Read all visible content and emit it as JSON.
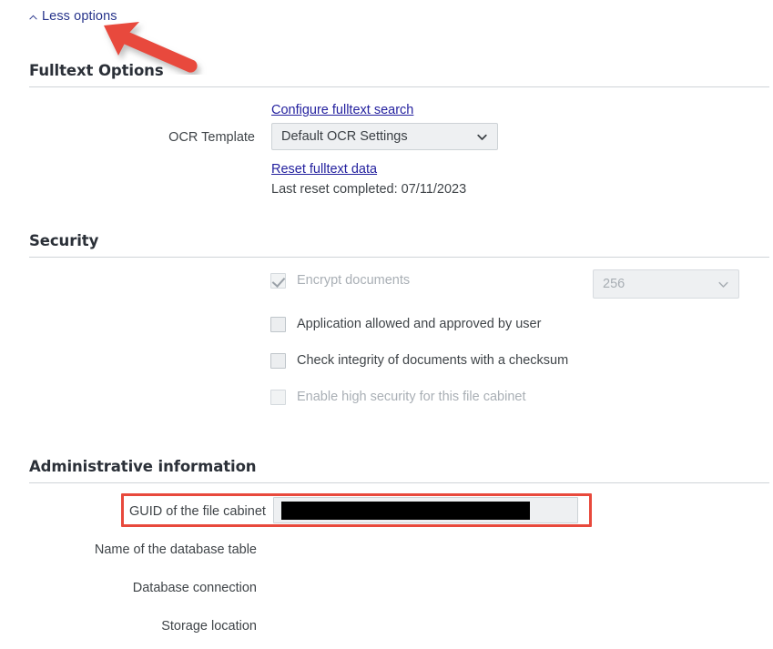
{
  "toggle": {
    "label": "Less options",
    "icon": "chevron-up-icon"
  },
  "annotation": {
    "shape": "arrow",
    "color": "#e8493c",
    "points_to": "Less options"
  },
  "sections": {
    "fulltext": {
      "title": "Fulltext Options",
      "configure_link": "Configure fulltext search",
      "ocr_template_label": "OCR Template",
      "ocr_template_value": "Default OCR Settings",
      "reset_link": "Reset fulltext data",
      "last_reset": "Last reset completed: 07/11/2023"
    },
    "security": {
      "title": "Security",
      "checkboxes": [
        {
          "label": "Encrypt documents",
          "checked": true,
          "disabled": true
        },
        {
          "label": "Application allowed and approved by user",
          "checked": false,
          "disabled": false
        },
        {
          "label": "Check integrity of documents with a checksum",
          "checked": false,
          "disabled": false
        },
        {
          "label": "Enable high security for this file cabinet",
          "checked": false,
          "disabled": true
        }
      ],
      "encryption_strength_value": "256"
    },
    "administrative": {
      "title": "Administrative information",
      "guid_label": "GUID of the file cabinet",
      "guid_value": "",
      "guid_redacted": true,
      "db_table_label": "Name of the database table",
      "db_table_value": "",
      "db_connection_label": "Database connection",
      "db_connection_value": "",
      "storage_location_label": "Storage location",
      "storage_location_value": ""
    }
  },
  "colors": {
    "link": "#221f9e",
    "heading": "#2b3038",
    "annotation": "#e8493c",
    "rule": "#cfd4d8"
  }
}
